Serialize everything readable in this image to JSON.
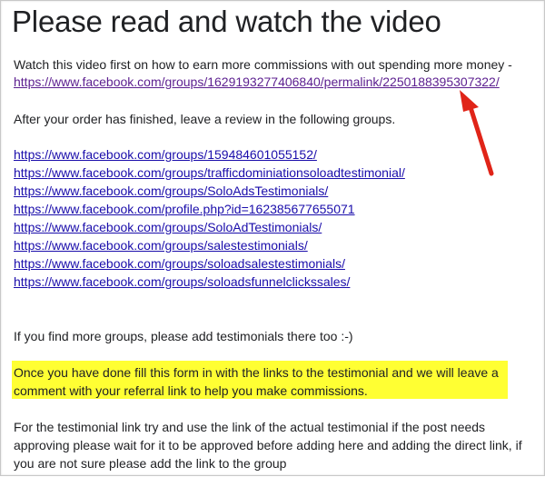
{
  "title": "Please read and watch the video",
  "intro": {
    "line": "Watch this video first on how to earn more commissions with out spending more money -",
    "video_link": "https://www.facebook.com/groups/1629193277406840/permalink/2250188395307322/"
  },
  "review_instruction": "After your order has finished, leave a review in the following groups.",
  "group_links": [
    "https://www.facebook.com/groups/159484601055152/",
    "https://www.facebook.com/groups/trafficdominiationsoloadtestimonial/",
    "https://www.facebook.com/groups/SoloAdsTestimonials/",
    "https://www.facebook.com/profile.php?id=162385677655071",
    "https://www.facebook.com/groups/SoloAdTestimonials/",
    "https://www.facebook.com/groups/salestestimonials/",
    "https://www.facebook.com/groups/soloadsalestestimonials/",
    "https://www.facebook.com/groups/soloadsfunnelclickssales/"
  ],
  "more_groups": "If you find more groups, please add testimonials there too :-)",
  "highlight": {
    "line1": "Once you have done fill this form in with the links to the testimonial and we will leave a",
    "line2": "comment with your referral link to help you make commissions.",
    "color": "#ffff33"
  },
  "footer": {
    "line1": "For the testimonial link try and use the link of the actual testimonial if the post needs",
    "line2": "approving please wait for it to be approved before adding here and adding the direct link, if",
    "line3": "you are not sure please add the link to the group"
  },
  "annotation": {
    "arrow_color": "#e02418",
    "icon": "red-arrow-icon"
  }
}
